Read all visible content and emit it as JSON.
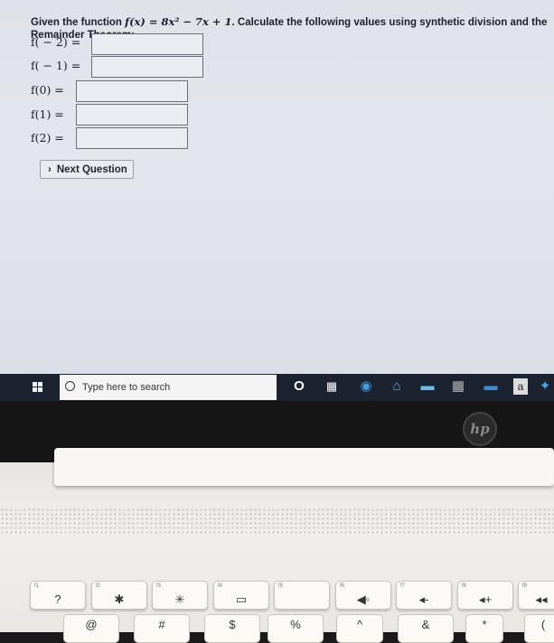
{
  "question": {
    "prefix": "Given the function ",
    "func": "f(x) = 8x² − 7x + 1",
    "suffix": ". Calculate the following values using synthetic division and the",
    "line2": "Remainder Theorem:"
  },
  "rows": [
    {
      "label": "f( − 2) =",
      "value": ""
    },
    {
      "label": "f( − 1) =",
      "value": ""
    },
    {
      "label": "f(0) =",
      "value": ""
    },
    {
      "label": "f(1) =",
      "value": ""
    },
    {
      "label": "f(2) =",
      "value": ""
    }
  ],
  "next_button": {
    "chevron": "›",
    "label": "Next Question"
  },
  "taskbar": {
    "search_placeholder": "Type here to search",
    "icons": [
      "windows-start-icon",
      "search-icon",
      "cortana-icon",
      "task-view-icon",
      "edge-icon",
      "store-icon",
      "photos-icon",
      "calculator-icon",
      "mail-icon",
      "amazon-icon",
      "app-icon"
    ],
    "amazon_glyph": "a"
  },
  "brand": {
    "logo": "hp"
  },
  "keyboard": {
    "fn_keys": [
      {
        "sub": "f1",
        "main": "?"
      },
      {
        "sub": "f2",
        "main": "✱"
      },
      {
        "sub": "f3",
        "main": "✳"
      },
      {
        "sub": "f4",
        "main": "▭"
      },
      {
        "sub": "f5",
        "main": ""
      },
      {
        "sub": "f6",
        "main": "◀◦"
      },
      {
        "sub": "f7",
        "main": "◂-"
      },
      {
        "sub": "f8",
        "main": "◂+"
      },
      {
        "sub": "f9",
        "main": "◂◂"
      }
    ],
    "num_keys": [
      "@",
      "#",
      "$",
      "%",
      "^",
      "&",
      "*",
      "("
    ]
  },
  "colors": {
    "screen_bg": "#e0e3e9",
    "taskbar": "#1c2330",
    "laptop_body": "#efede9"
  }
}
